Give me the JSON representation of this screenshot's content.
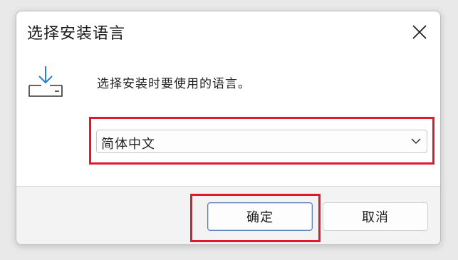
{
  "dialog": {
    "title": "选择安装语言",
    "prompt": "选择安装时要使用的语言。",
    "language_select": {
      "selected": "简体中文"
    },
    "buttons": {
      "ok_label": "确定",
      "cancel_label": "取消"
    },
    "highlight_color": "#e0192c"
  }
}
